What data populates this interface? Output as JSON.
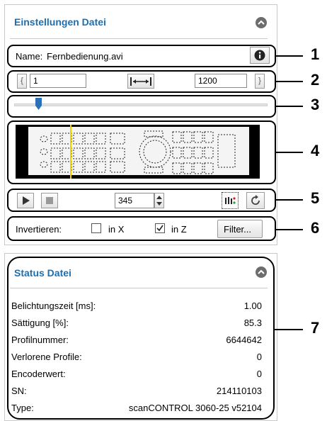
{
  "file_settings": {
    "title": "Einstellungen Datei",
    "name_label": "Name:",
    "name_value": "Fernbedienung.avi",
    "range_start": "1",
    "range_end": "1200",
    "slider_fraction": 0.096,
    "frame_value": "345",
    "invert_label": "Invertieren:",
    "invert_x_label": "in X",
    "invert_x_checked": false,
    "invert_z_label": "in Z",
    "invert_z_checked": true,
    "filter_label": "Filter..."
  },
  "status": {
    "title": "Status Datei",
    "rows": [
      {
        "label": "Belichtungszeit [ms]:",
        "value": "1.00"
      },
      {
        "label": "Sättigung [%]:",
        "value": "85.3"
      },
      {
        "label": "Profilnummer:",
        "value": "6644642"
      },
      {
        "label": "Verlorene Profile:",
        "value": "0"
      },
      {
        "label": "Encoderwert:",
        "value": "0"
      },
      {
        "label": "SN:",
        "value": "214110103"
      },
      {
        "label": "Type:",
        "value": "scanCONTROL 3060-25 v52104"
      }
    ]
  },
  "callouts": [
    "1",
    "2",
    "3",
    "4",
    "5",
    "6",
    "7"
  ],
  "colors": {
    "title": "#1b6fb3",
    "slider": "#2b6fb7",
    "cursor_line": "#f2d000"
  }
}
